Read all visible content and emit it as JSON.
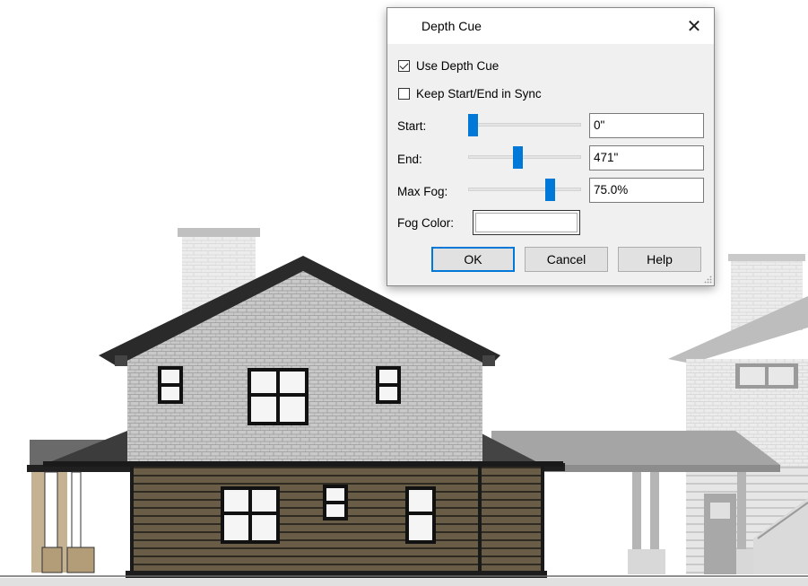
{
  "dialog": {
    "title": "Depth Cue",
    "close_icon": "close-icon",
    "use_depth_cue": {
      "label": "Use Depth Cue",
      "checked": true
    },
    "keep_sync": {
      "label": "Keep Start/End in Sync",
      "checked": false
    },
    "start": {
      "label": "Start:",
      "value": "0\""
    },
    "end": {
      "label": "End:",
      "value": "471\""
    },
    "max_fog": {
      "label": "Max Fog:",
      "value": "75.0%"
    },
    "fog_color": {
      "label": "Fog Color:",
      "color": "#ffffff"
    },
    "buttons": {
      "ok": "OK",
      "cancel": "Cancel",
      "help": "Help"
    }
  },
  "colors": {
    "accent": "#0078d7",
    "siding": "#5a4f3e",
    "roof": "#2e2e2e",
    "shingle": "#c4c4c4"
  }
}
